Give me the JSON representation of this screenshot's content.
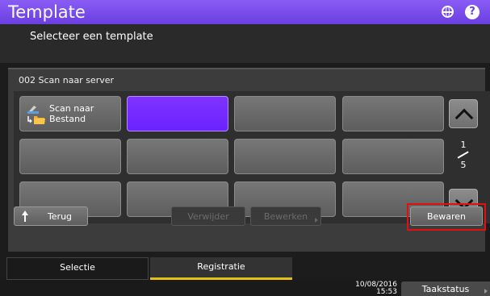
{
  "header": {
    "title": "Template",
    "subtitle": "Selecteer een template",
    "globe_icon": "globe-icon",
    "help_icon": "help-icon",
    "help_glyph": "?"
  },
  "template_name": "002 Scan naar server",
  "grid": {
    "cells": [
      {
        "label": "Scan naar\nBestand",
        "icon": "scan-to-file-icon",
        "selected": false
      },
      {
        "label": "",
        "selected": true
      },
      {
        "label": "",
        "selected": false
      },
      {
        "label": "",
        "selected": false
      },
      {
        "label": "",
        "selected": false
      },
      {
        "label": "",
        "selected": false
      },
      {
        "label": "",
        "selected": false
      },
      {
        "label": "",
        "selected": false
      },
      {
        "label": "",
        "selected": false
      },
      {
        "label": "",
        "selected": false
      },
      {
        "label": "",
        "selected": false
      },
      {
        "label": "",
        "selected": false
      }
    ],
    "page_current": "1",
    "page_total": "5"
  },
  "buttons": {
    "back": "Terug",
    "delete": "Verwijder",
    "edit": "Bewerken",
    "save": "Bewaren"
  },
  "tabs": [
    {
      "label": "Selectie",
      "active": false
    },
    {
      "label": "Registratie",
      "active": true
    }
  ],
  "status": {
    "date": "10/08/2016",
    "time": "15:53",
    "job_status": "Taakstatus"
  },
  "colors": {
    "titlebar": "#7c4dff",
    "selected_cell": "#7b2dff",
    "active_tab_underline": "#e8c015",
    "save_highlight": "#e01010"
  }
}
